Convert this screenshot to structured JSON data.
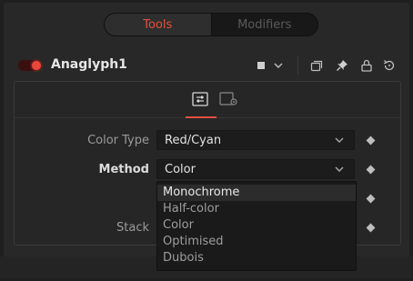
{
  "tabs": {
    "tools": "Tools",
    "modifiers": "Modifiers"
  },
  "node": {
    "name": "Anaglyph1",
    "enabled": true
  },
  "colors": {
    "accent": "#e4503d",
    "toggle_on": "#e8473a"
  },
  "panel_tabs": {
    "active": "controls-icon",
    "other": "settings-icon"
  },
  "fields": {
    "color_type": {
      "label": "Color Type",
      "value": "Red/Cyan"
    },
    "method": {
      "label": "Method",
      "value": "Color"
    },
    "stack": {
      "label": "Stack"
    }
  },
  "method_options": [
    "Monochrome",
    "Half-color",
    "Color",
    "Optimised",
    "Dubois"
  ],
  "method_highlighted": "Monochrome"
}
